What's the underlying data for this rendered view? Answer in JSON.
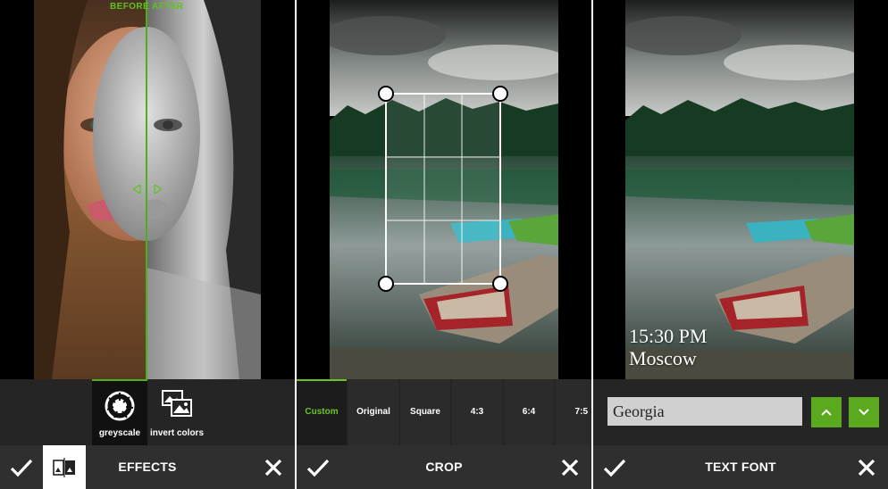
{
  "effects_screen": {
    "before_label": "BEFORE",
    "after_label": "AFTER",
    "effects": [
      {
        "label": "greyscale",
        "icon": "aperture-icon",
        "selected": true
      },
      {
        "label": "invert colors",
        "icon": "images-icon",
        "selected": false
      }
    ],
    "title": "EFFECTS",
    "accent_color": "#4caf1c"
  },
  "crop_screen": {
    "ratios": [
      {
        "label": "Custom",
        "active": true
      },
      {
        "label": "Original",
        "active": false
      },
      {
        "label": "Square",
        "active": false
      },
      {
        "label": "4:3",
        "active": false
      },
      {
        "label": "6:4",
        "active": false
      },
      {
        "label": "7:5",
        "active": false
      }
    ],
    "title": "CROP"
  },
  "text_font_screen": {
    "overlay_time": "15:30 PM",
    "overlay_city": "Moscow",
    "font_value": "Georgia",
    "title": "TEXT FONT",
    "button_color": "#5aa91f"
  }
}
